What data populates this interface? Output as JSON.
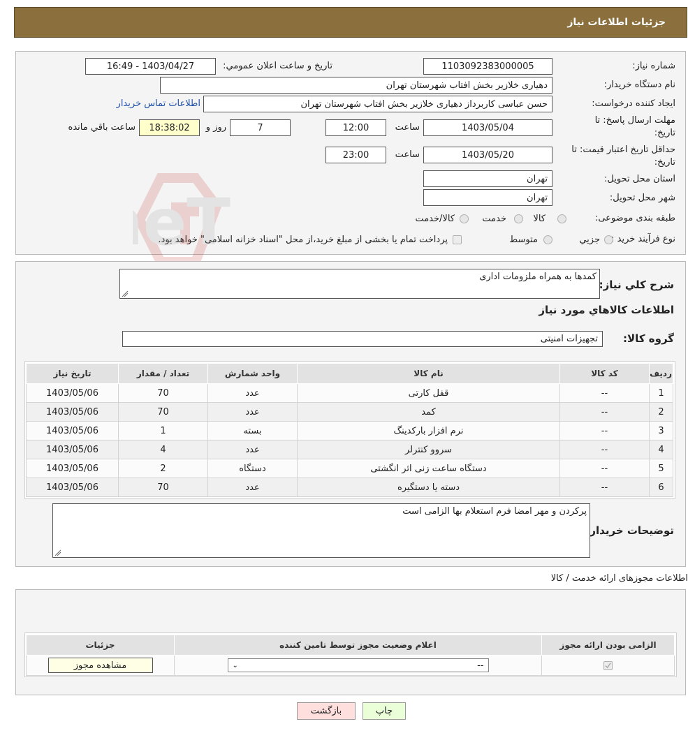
{
  "header": {
    "title": "جزئیات اطلاعات نیاز"
  },
  "details": {
    "need_number_label": "شماره نیاز:",
    "need_number": "1103092383000005",
    "announce_label": "تاریخ و ساعت اعلان عمومي:",
    "announce_value": "1403/04/27 - 16:49",
    "buyer_org_label": "نام دستگاه خریدار:",
    "buyer_org": "دهیاری خلازیر بخش افتاب شهرستان تهران",
    "creator_label": "ایجاد کننده درخواست:",
    "creator": "حسن عباسی کاربرداز دهیاری خلازیر بخش افتاب شهرستان تهران",
    "contact_link": "اطلاعات تماس خریدار",
    "reply_deadline_label_1": "مهلت ارسال پاسخ: تا",
    "reply_deadline_label_2": "تاریخ:",
    "reply_date": "1403/05/04",
    "time_label": "ساعت",
    "reply_time": "12:00",
    "days_value": "7",
    "days_label": "روز و",
    "remaining_time": "18:38:02",
    "remaining_label": "ساعت باقي مانده",
    "validity_label_1": "حداقل تاریخ اعتبار قیمت: تا",
    "validity_label_2": "تاریخ:",
    "validity_date": "1403/05/20",
    "validity_time": "23:00",
    "province_label": "استان محل تحویل:",
    "province": "تهران",
    "city_label": "شهر محل تحویل:",
    "city": "تهران",
    "category_label": "طبقه بندی موضوعی:",
    "category_options": [
      "كالا",
      "خدمت",
      "كالا/خدمت"
    ],
    "process_label": "نوع فرآیند خرید :",
    "process_options": [
      "جزيي",
      "متوسط"
    ],
    "payment_note": "پرداخت تمام یا بخشی از مبلغ خرید،از محل \"اسناد خزانه اسلامی\" خواهد بود."
  },
  "description": {
    "label": "شرح كلي نياز:",
    "value": "کمدها به همراه ملزومات اداری",
    "goods_heading": "اطلاعات كالاهاي مورد نياز",
    "group_label": "گروه کالا:",
    "group_value": "تجهیزات امنیتی"
  },
  "goods_table": {
    "columns": [
      "رديف",
      "كد كالا",
      "نام كالا",
      "واحد شمارش",
      "تعداد / مقدار",
      "تاريخ نياز"
    ],
    "rows": [
      [
        "1",
        "--",
        "قفل کارتی",
        "عدد",
        "70",
        "1403/05/06"
      ],
      [
        "2",
        "--",
        "کمد",
        "عدد",
        "70",
        "1403/05/06"
      ],
      [
        "3",
        "--",
        "نرم افزار بارکدینگ",
        "بسته",
        "1",
        "1403/05/06"
      ],
      [
        "4",
        "--",
        "سروو کنترلر",
        "عدد",
        "4",
        "1403/05/06"
      ],
      [
        "5",
        "--",
        "دستگاه ساعت زنی اثر انگشتی",
        "دستگاه",
        "2",
        "1403/05/06"
      ],
      [
        "6",
        "--",
        "دسته یا دستگیره",
        "عدد",
        "70",
        "1403/05/06"
      ]
    ]
  },
  "buyer_notes": {
    "label": "توضیحات خریدار:",
    "value": "پرکردن و مهر امضا فرم استعلام بها الزامی است"
  },
  "permits": {
    "heading": "اطلاعات مجوزهای ارائه خدمت / کالا",
    "columns": [
      "الزامی بودن ارائه مجوز",
      "اعلام وضعیت مجوز توسط تامین کننده",
      "جزئیات"
    ],
    "select_value": "--",
    "view_button": "مشاهده مجوز"
  },
  "footer": {
    "print_label": "چاپ",
    "back_label": "بازگشت"
  },
  "watermark": {
    "text": "AriaTender.neT"
  },
  "colors": {
    "titlebar": "#8b6f3c",
    "link": "#1f4fa8",
    "print_bg": "#eaffd8",
    "back_bg": "#ffdede"
  }
}
